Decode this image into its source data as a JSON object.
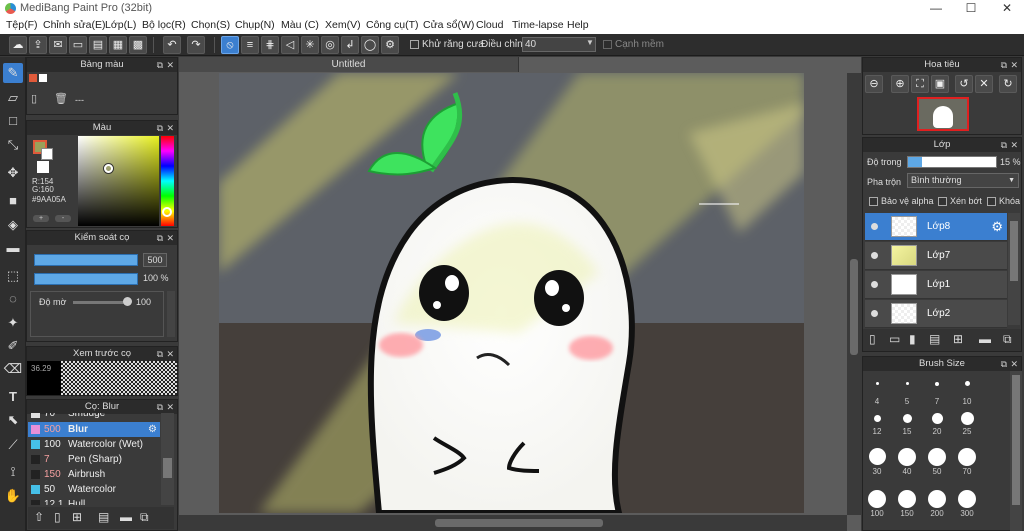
{
  "window": {
    "title": "MediBang Paint Pro (32bit)"
  },
  "menu": [
    "Tệp(F)",
    "Chỉnh sửa(E)",
    "Lớp(L)",
    "Bộ lọc(R)",
    "Chọn(S)",
    "Chụp(N)",
    "Màu (C)",
    "Xem(V)",
    "Công cụ(T)",
    "Cửa sổ(W)",
    "Cloud",
    "Time-lapse",
    "Help"
  ],
  "toolbar": {
    "antialias_label": "Khử răng cưa",
    "adjust_label": "Điều chỉnh",
    "adjust_value": "40",
    "edge_label": "Cạnh mềm"
  },
  "doc": {
    "tab": "Untitled"
  },
  "palette": {
    "title": "Bảng màu",
    "dash": "---"
  },
  "color": {
    "title": "Màu",
    "r": "R:154",
    "g": "G:160",
    "hex": "#9AA05A",
    "fg": "#9AA05A"
  },
  "brushctl": {
    "title": "Kiểm soát cọ",
    "size": "500",
    "opacity": "100 %",
    "density_label": "Độ mờ",
    "density_value": "100"
  },
  "preview": {
    "title": "Xem trước cọ",
    "value": "36.29"
  },
  "brushes": {
    "title": "Cọ: Blur",
    "items": [
      {
        "size": "70",
        "name": "Smudge",
        "color": "#e0e0e0"
      },
      {
        "size": "500",
        "name": "Blur",
        "color": "#e890d8",
        "sel": true
      },
      {
        "size": "100",
        "name": "Watercolor (Wet)",
        "color": "#46c0e8"
      },
      {
        "size": "7",
        "name": "Pen (Sharp)",
        "color": "#222222"
      },
      {
        "size": "150",
        "name": "Airbrush",
        "color": "#222222"
      },
      {
        "size": "50",
        "name": "Watercolor",
        "color": "#46c0e8"
      },
      {
        "size": "12.1",
        "name": "Hull",
        "color": "#222222"
      }
    ]
  },
  "navigator": {
    "title": "Hoa tiêu"
  },
  "layers": {
    "title": "Lớp",
    "opacity_label": "Độ trong",
    "opacity_value": "15 %",
    "blend_label": "Pha trộn",
    "blend_value": "Bình thường",
    "protect_alpha": "Bảo vệ alpha",
    "clip": "Xén bớt",
    "lock": "Khóa",
    "items": [
      {
        "name": "Lớp8",
        "sel": true
      },
      {
        "name": "Lớp7"
      },
      {
        "name": "Lớp1"
      },
      {
        "name": "Lớp2"
      }
    ]
  },
  "brush_size": {
    "title": "Brush Size",
    "sizes": [
      "4",
      "5",
      "7",
      "10",
      "12",
      "15",
      "20",
      "25",
      "30",
      "40",
      "50",
      "70",
      "100",
      "150",
      "200",
      "300"
    ]
  }
}
